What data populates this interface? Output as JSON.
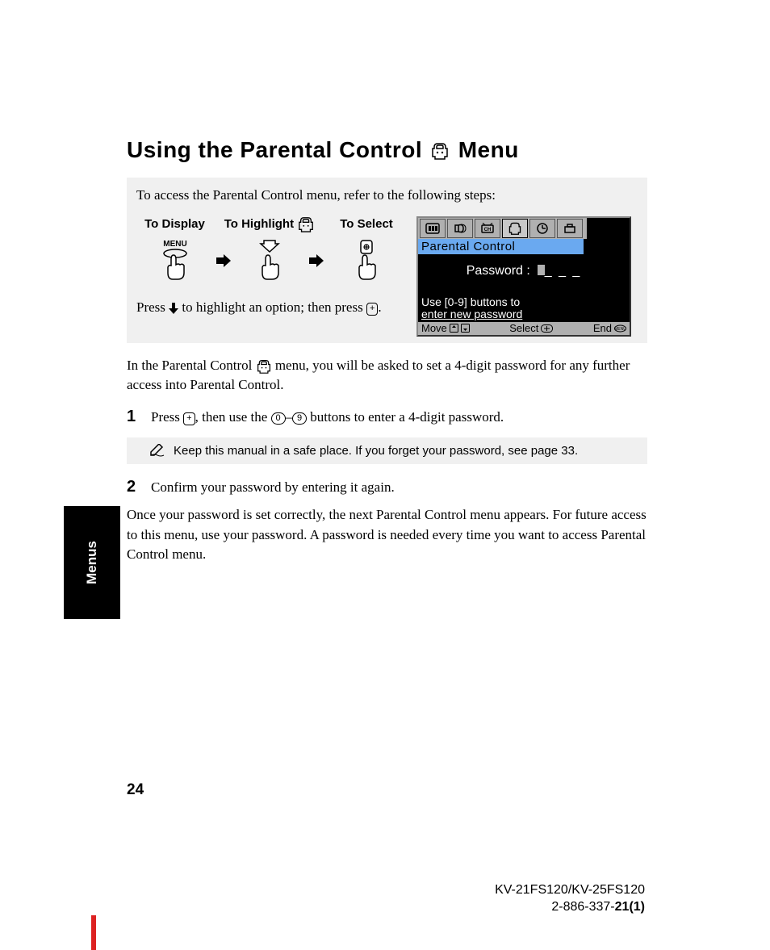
{
  "heading": {
    "part1": "Using the Parental Control",
    "part2": "Menu"
  },
  "graybox": {
    "intro": "To access the Parental Control menu, refer to the following steps:",
    "labels": {
      "display": "To Display",
      "highlight": "To Highlight",
      "select": "To Select"
    },
    "menu_label": "MENU",
    "press_line_1": "Press ",
    "press_line_2": " to highlight an option; then press ",
    "press_line_3": "."
  },
  "osd": {
    "title": "Parental Control",
    "password_label": "Password :",
    "password_mask": "_ _ _",
    "hint_line1": "Use [0-9] buttons to",
    "hint_line2": "enter new password",
    "footer": {
      "move": "Move",
      "select": "Select",
      "end": "End"
    }
  },
  "para1_a": "In the Parental Control ",
  "para1_b": " menu, you will be asked to set a 4-digit password for any further access into Parental Control.",
  "step1": {
    "num": "1",
    "a": "Press ",
    "b": ", then use the ",
    "c": " buttons to enter a 4-digit password.",
    "zero": "0",
    "nine": "9",
    "dash": "–",
    "plus": "+"
  },
  "note": "Keep this manual in a safe place. If you forget your password, see page 33.",
  "step2": {
    "num": "2",
    "text": "Confirm your password by entering it again."
  },
  "para2": "Once your password is set correctly, the next Parental Control menu appears. For future access to this menu, use your password. A password is needed every time you want to access Parental Control menu.",
  "side_tab": "Menus",
  "page_number": "24",
  "footer": {
    "models": "KV-21FS120/KV-25FS120",
    "docnum_a": "2-886-337-",
    "docnum_b": "21(1)"
  }
}
